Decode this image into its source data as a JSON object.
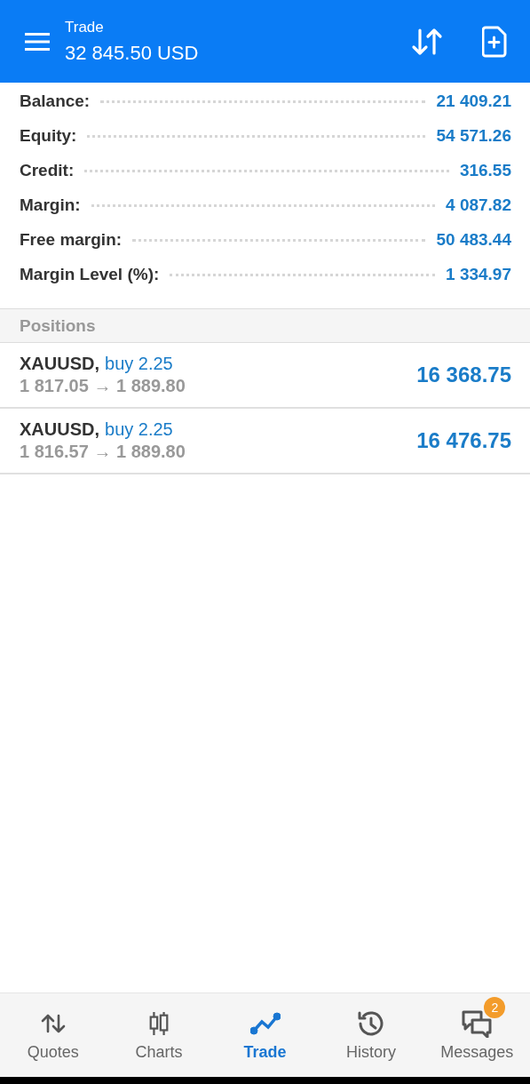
{
  "header": {
    "title": "Trade",
    "subtitle": "32 845.50 USD"
  },
  "summary": [
    {
      "label": "Balance:",
      "value": "21 409.21"
    },
    {
      "label": "Equity:",
      "value": "54 571.26"
    },
    {
      "label": "Credit:",
      "value": "316.55"
    },
    {
      "label": "Margin:",
      "value": "4 087.82"
    },
    {
      "label": "Free margin:",
      "value": "50 483.44"
    },
    {
      "label": "Margin Level (%):",
      "value": "1 334.97"
    }
  ],
  "positions": {
    "title": "Positions",
    "rows": [
      {
        "symbol": "XAUUSD,",
        "order": "buy 2.25",
        "prices": "1 817.05 → 1 889.80",
        "profit": "16 368.75"
      },
      {
        "symbol": "XAUUSD,",
        "order": "buy 2.25",
        "prices": "1 816.57 → 1 889.80",
        "profit": "16 476.75"
      }
    ]
  },
  "nav": [
    {
      "kind": "quotes",
      "label": "Quotes",
      "selected": false
    },
    {
      "kind": "charts",
      "label": "Charts",
      "selected": false
    },
    {
      "kind": "trade",
      "label": "Trade",
      "selected": true
    },
    {
      "kind": "history",
      "label": "History",
      "selected": false
    },
    {
      "kind": "messages",
      "label": "Messages",
      "selected": false,
      "badge": "2"
    }
  ]
}
